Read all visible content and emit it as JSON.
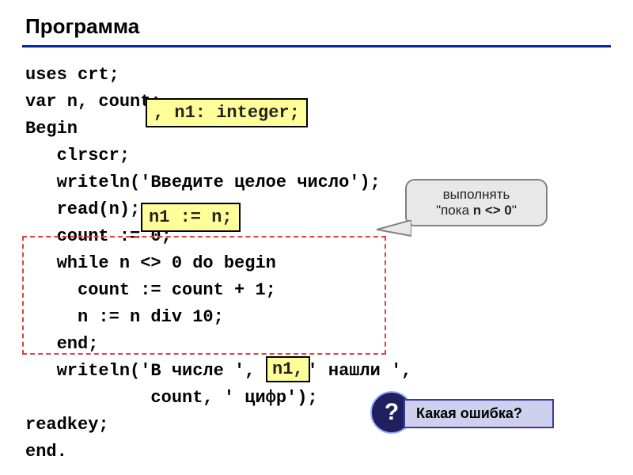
{
  "title": "Программа",
  "code": "uses crt;\nvar n, count:\nBegin\n   clrscr;\n   writeln('Введите целое число');\n   read(n);\n   count := 0;\n   while n <> 0 do begin\n     count := count + 1;\n     n := n div 10;\n   end;\n   writeln('В числе ',    ,' нашли ',\n            count, ' цифр');\nreadkey;\nend.",
  "overlays": {
    "n1_integer": ", n1: integer;",
    "n1_assign": "n1 := n;",
    "n1_ref": "n1,"
  },
  "speech": {
    "line1": "выполнять",
    "line2_prefix": "\"пока ",
    "line2_cond": "n <> 0",
    "line2_suffix": "\""
  },
  "question_mark": "?",
  "error_label": "Какая ошибка?"
}
